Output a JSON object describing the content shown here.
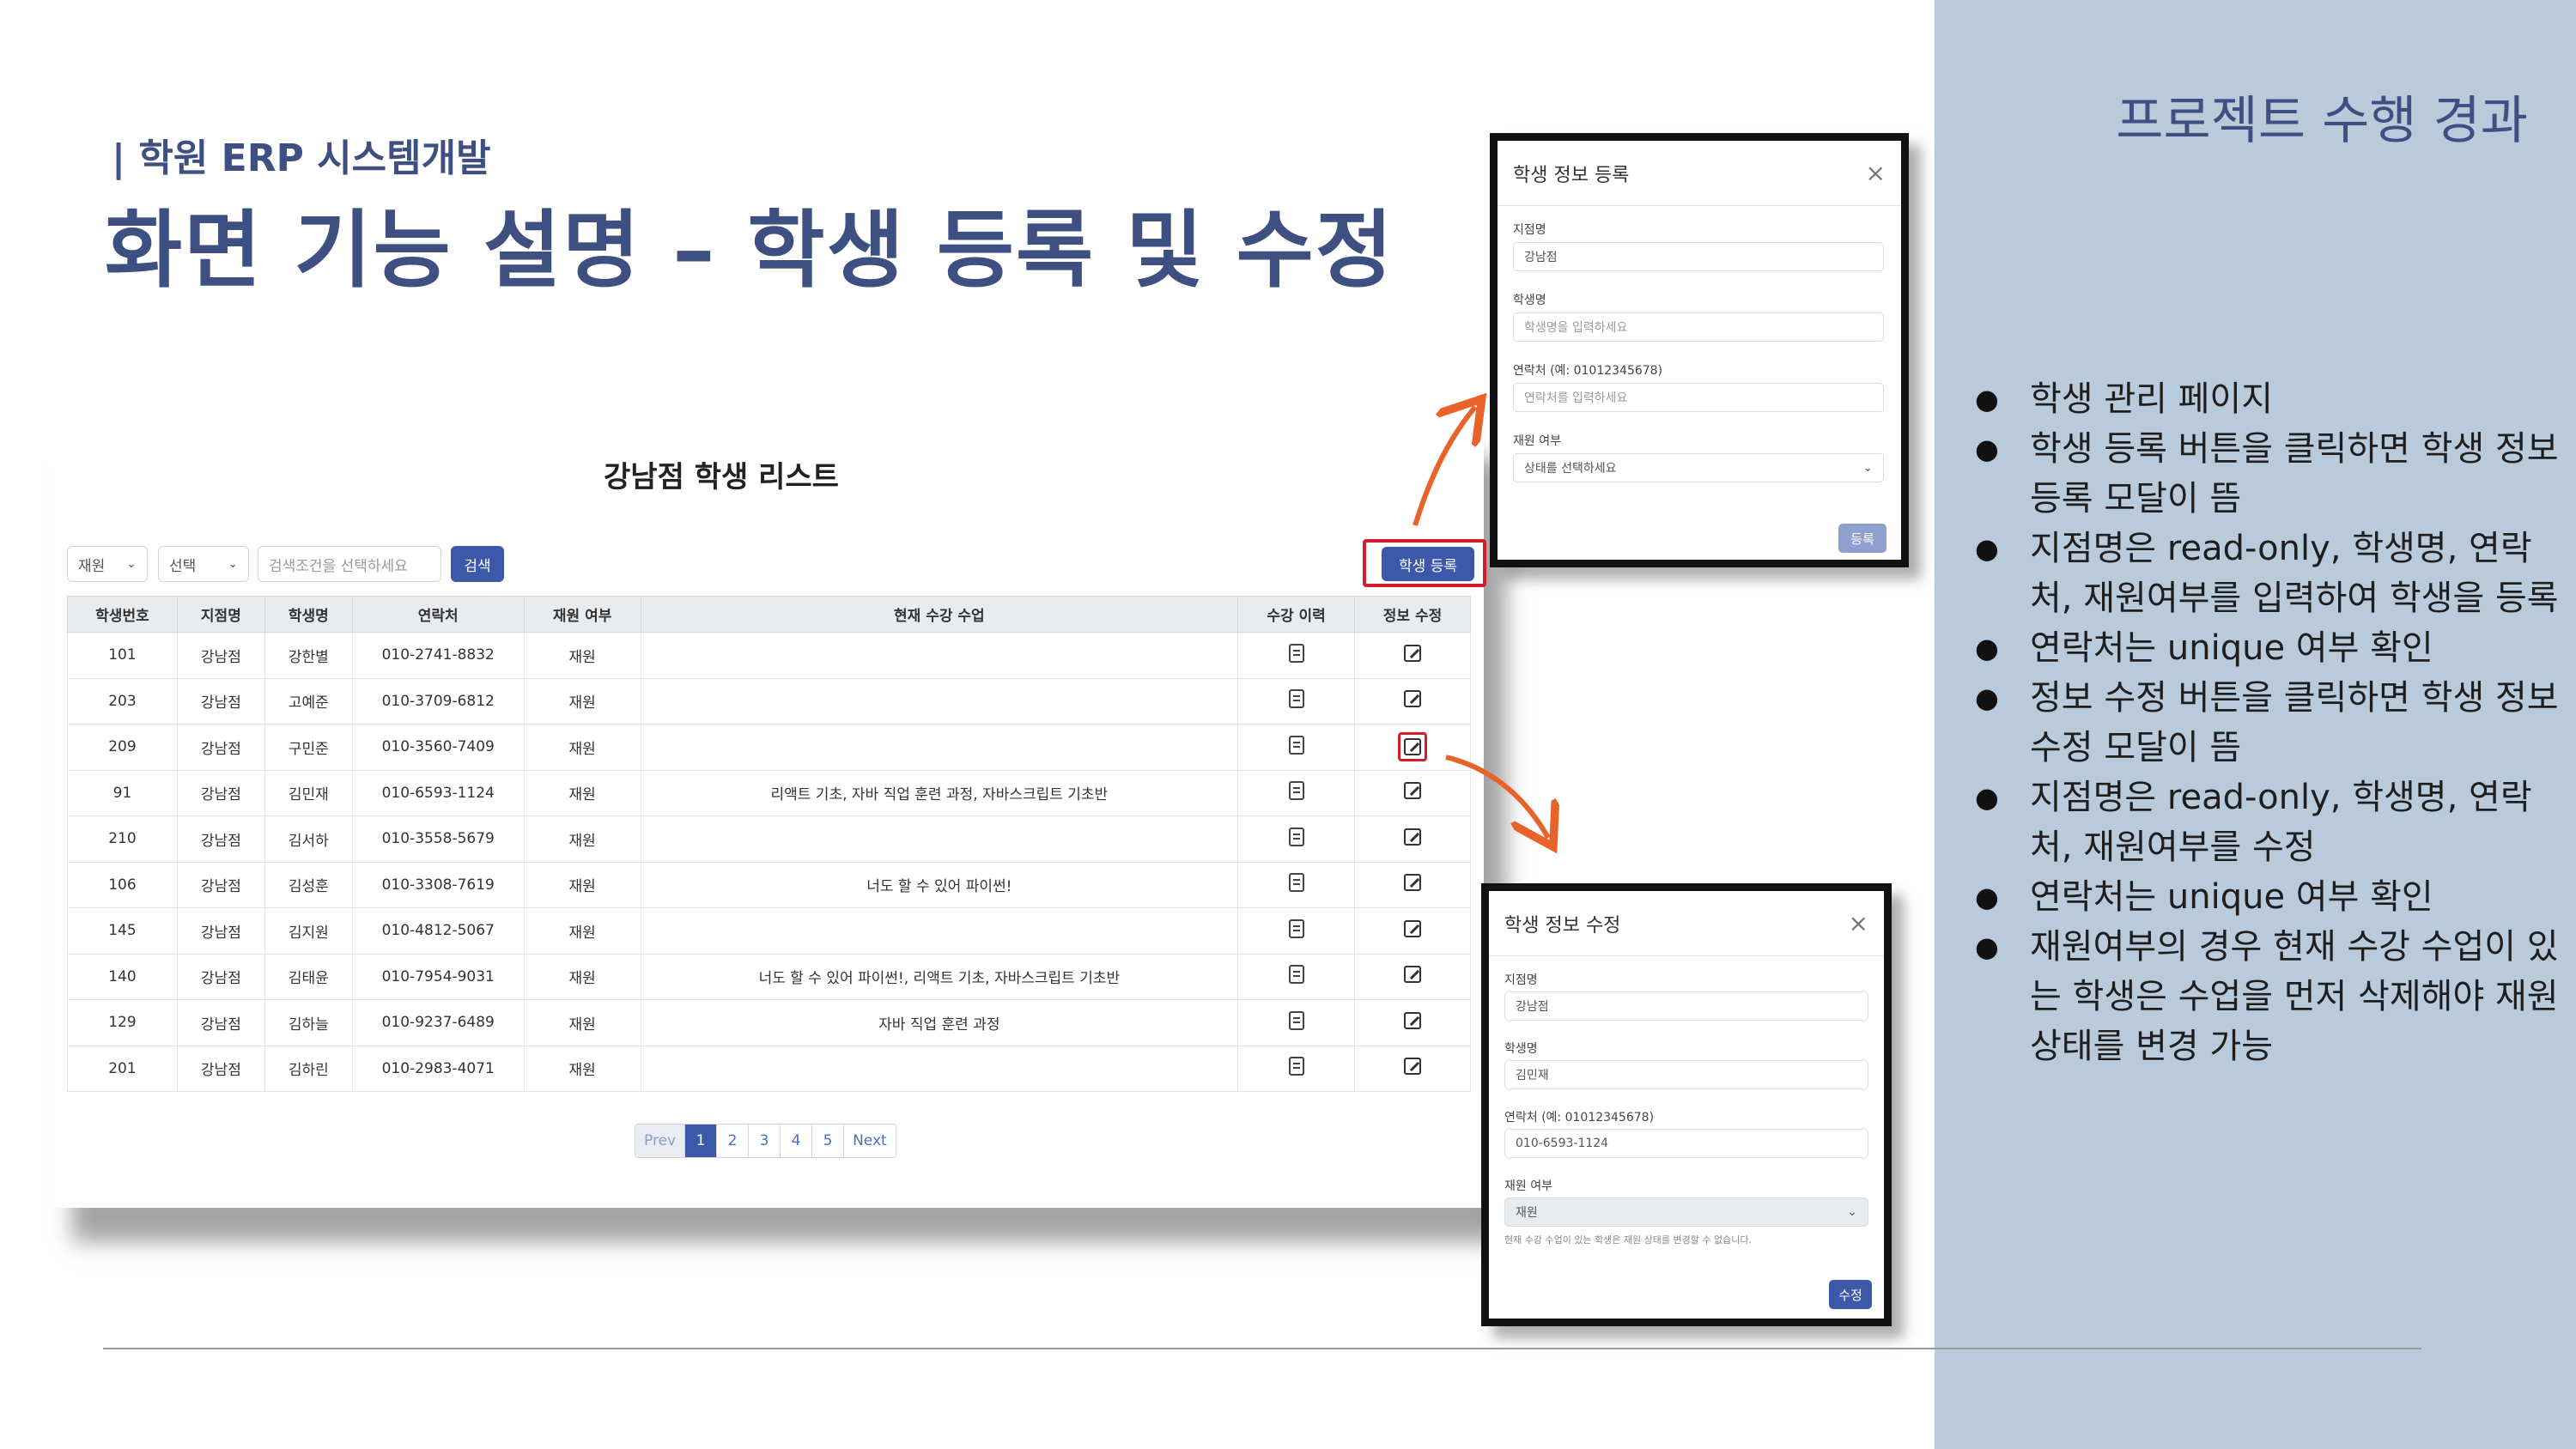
{
  "slide": {
    "eyebrow": "| 학원 ERP 시스템개발",
    "title": "화면 기능 설명 – 학생 등록 및 수정"
  },
  "panel": {
    "title": "프로젝트 수행 경과",
    "bullets": [
      "학생 관리 페이지",
      "학생 등록 버튼을 클릭하면 학생 정보 등록 모달이 뜸",
      "지점명은 read-only, 학생명, 연락처, 재원여부를 입력하여 학생을 등록",
      "연락처는 unique 여부 확인",
      "정보 수정 버튼을 클릭하면 학생 정보 수정 모달이 뜸",
      "지점명은 read-only, 학생명, 연락처, 재원여부를 수정",
      "연락처는 unique 여부 확인",
      "재원여부의 경우 현재 수강 수업이 있는 학생은 수업을 먼저 삭제해야 재원 상태를 변경 가능"
    ]
  },
  "list": {
    "title": "강남점 학생 리스트",
    "filter_status": "재원",
    "filter_field": "선택",
    "search_placeholder": "검색조건을 선택하세요",
    "search_label": "검색",
    "register_label": "학생 등록",
    "columns": [
      "학생번호",
      "지점명",
      "학생명",
      "연락처",
      "재원 여부",
      "현재 수강 수업",
      "수강 이력",
      "정보 수정"
    ],
    "rows": [
      {
        "id": "101",
        "branch": "강남점",
        "name": "강한별",
        "phone": "010-2741-8832",
        "status": "재원",
        "classes": ""
      },
      {
        "id": "203",
        "branch": "강남점",
        "name": "고예준",
        "phone": "010-3709-6812",
        "status": "재원",
        "classes": ""
      },
      {
        "id": "209",
        "branch": "강남점",
        "name": "구민준",
        "phone": "010-3560-7409",
        "status": "재원",
        "classes": ""
      },
      {
        "id": "91",
        "branch": "강남점",
        "name": "김민재",
        "phone": "010-6593-1124",
        "status": "재원",
        "classes": "리액트 기초, 자바 직업 훈련 과정, 자바스크립트 기초반"
      },
      {
        "id": "210",
        "branch": "강남점",
        "name": "김서하",
        "phone": "010-3558-5679",
        "status": "재원",
        "classes": ""
      },
      {
        "id": "106",
        "branch": "강남점",
        "name": "김성훈",
        "phone": "010-3308-7619",
        "status": "재원",
        "classes": "너도 할 수 있어 파이썬!"
      },
      {
        "id": "145",
        "branch": "강남점",
        "name": "김지원",
        "phone": "010-4812-5067",
        "status": "재원",
        "classes": ""
      },
      {
        "id": "140",
        "branch": "강남점",
        "name": "김태윤",
        "phone": "010-7954-9031",
        "status": "재원",
        "classes": "너도 할 수 있어 파이썬!, 리액트 기초, 자바스크립트 기초반"
      },
      {
        "id": "129",
        "branch": "강남점",
        "name": "김하늘",
        "phone": "010-9237-6489",
        "status": "재원",
        "classes": "자바 직업 훈련 과정"
      },
      {
        "id": "201",
        "branch": "강남점",
        "name": "김하린",
        "phone": "010-2983-4071",
        "status": "재원",
        "classes": ""
      }
    ],
    "pagination": {
      "prev": "Prev",
      "pages": [
        "1",
        "2",
        "3",
        "4",
        "5"
      ],
      "next": "Next",
      "current": "1"
    }
  },
  "register_modal": {
    "title": "학생 정보 등록",
    "close": "×",
    "branch_label": "지점명",
    "branch_value": "강남점",
    "name_label": "학생명",
    "name_placeholder": "학생명을 입력하세요",
    "phone_label": "연락처 (예: 01012345678)",
    "phone_placeholder": "연락처를 입력하세요",
    "status_label": "재원 여부",
    "status_placeholder": "상태를 선택하세요",
    "submit": "등록"
  },
  "edit_modal": {
    "title": "학생 정보 수정",
    "close": "×",
    "branch_label": "지점명",
    "branch_value": "강남점",
    "name_label": "학생명",
    "name_value": "김민재",
    "phone_label": "연락처 (예: 01012345678)",
    "phone_value": "010-6593-1124",
    "status_label": "재원 여부",
    "status_value": "재원",
    "status_help": "현재 수강 수업이 있는 학생은 재원 상태를 변경할 수 없습니다.",
    "submit": "수정"
  },
  "colors": {
    "heading": "#3e4f82",
    "panel_bg": "#b9cadb",
    "primary_button": "#3c58a8",
    "highlight_red": "#d21f2b",
    "arrow_orange": "#e8622a"
  }
}
